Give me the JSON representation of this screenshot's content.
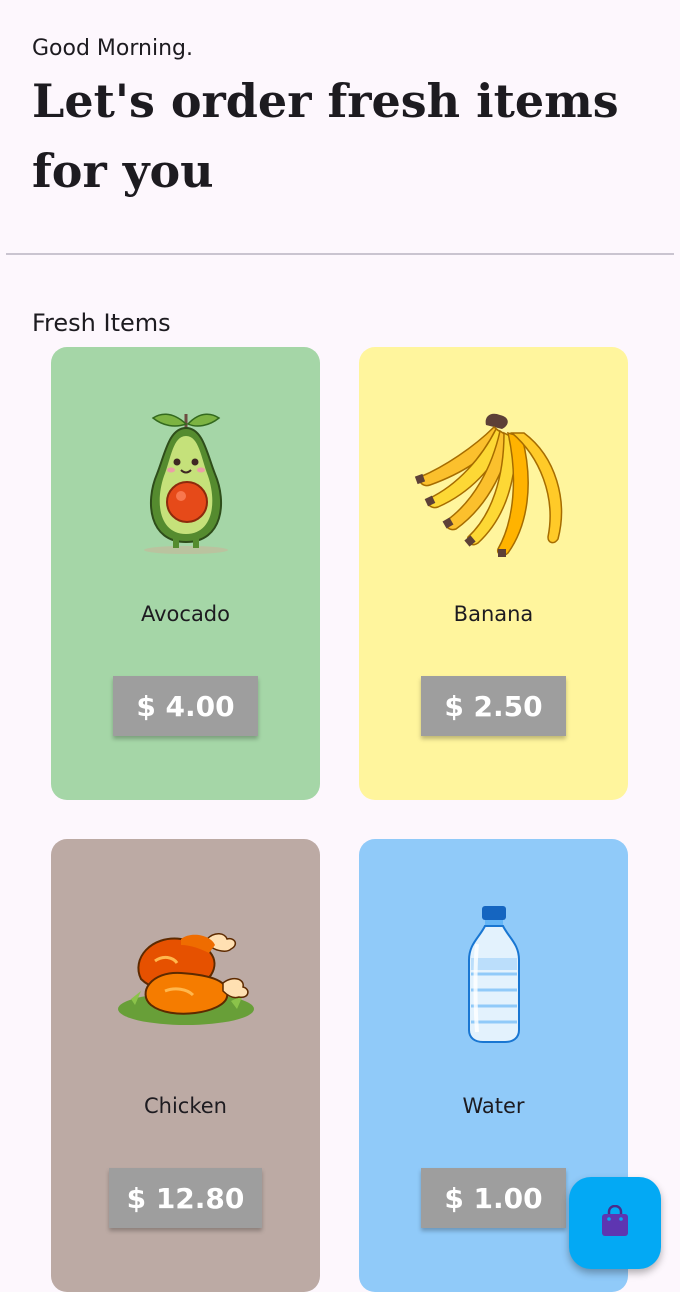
{
  "header": {
    "greeting": "Good Morning.",
    "title": "Let's order fresh items for you"
  },
  "section": {
    "title": "Fresh Items"
  },
  "items": [
    {
      "name": "Avocado",
      "price": "$ 4.00",
      "color": "#a5d6a7",
      "icon": "avocado-icon"
    },
    {
      "name": "Banana",
      "price": "$ 2.50",
      "color": "#fff59d",
      "icon": "banana-icon"
    },
    {
      "name": "Chicken",
      "price": "$ 12.80",
      "color": "#bcaaa4",
      "icon": "chicken-icon"
    },
    {
      "name": "Water",
      "price": "$ 1.00",
      "color": "#90caf9",
      "icon": "water-bottle-icon"
    }
  ],
  "fab": {
    "icon": "shopping-bag-icon",
    "color": "#03a9f4"
  }
}
